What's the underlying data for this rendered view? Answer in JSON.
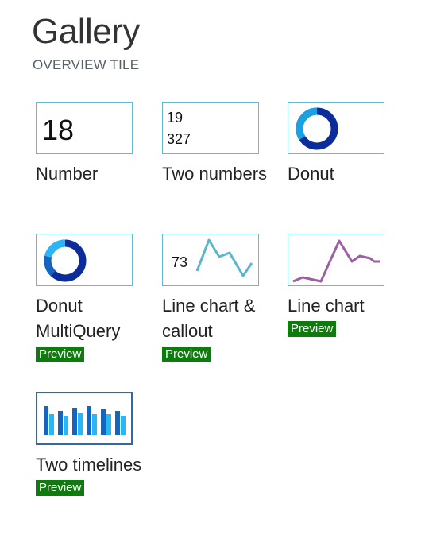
{
  "header": {
    "title": "Gallery",
    "subtitle": "OVERVIEW TILE"
  },
  "tiles": [
    {
      "label": "Number",
      "preview": "",
      "thumb": {
        "value": "18"
      }
    },
    {
      "label": "Two numbers",
      "preview": "",
      "thumb": {
        "value1": "19",
        "value2": "327"
      }
    },
    {
      "label": "Donut",
      "preview": "",
      "thumb": {
        "icon": "donut-chart-icon"
      }
    },
    {
      "label": "Donut MultiQuery",
      "preview": "Preview",
      "thumb": {
        "icon": "donut-chart-icon"
      }
    },
    {
      "label": "Line chart & callout",
      "preview": "Preview",
      "thumb": {
        "callout": "73",
        "icon": "line-chart-icon"
      }
    },
    {
      "label": "Line chart",
      "preview": "Preview",
      "thumb": {
        "icon": "line-chart-icon"
      }
    },
    {
      "label": "Two timelines",
      "preview": "Preview",
      "thumb": {
        "icon": "bar-timeline-icon"
      }
    }
  ],
  "colors": {
    "thumb_border": "#5fbcd3",
    "selected_border": "#2d6aa6",
    "preview_badge": "#0f7b0f",
    "donut_dark": "#0c2c99",
    "donut_light": "#1ba1e2",
    "line_teal": "#5ab6c8",
    "line_purple": "#9b5fa3",
    "bar_dark": "#1565c0",
    "bar_light": "#29b6f6"
  }
}
